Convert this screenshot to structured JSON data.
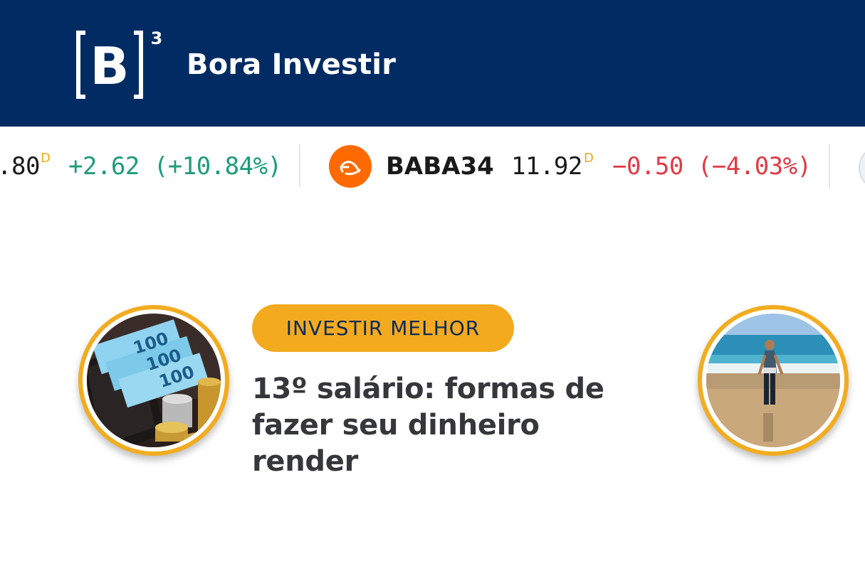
{
  "brand": {
    "name": "Bora Investir",
    "logo_letter": "B",
    "logo_superscript": "3"
  },
  "ticker": {
    "items": [
      {
        "symbol": "",
        "price": ".80",
        "marker": "D",
        "change": "+2.62 (+10.84%)",
        "direction": "up"
      },
      {
        "symbol": "BABA34",
        "price": "11.92",
        "marker": "D",
        "change": "−0.50 (−4.03%)",
        "direction": "down",
        "logo_icon": "alibaba-icon"
      }
    ],
    "colors": {
      "up": "#1e9b7b",
      "down": "#e03a44",
      "marker": "#f0a818"
    }
  },
  "featured": {
    "category": "INVESTIR MELHOR",
    "headline": "13º salário: formas de fazer seu dinheiro render",
    "left_image": "money-wallet-image",
    "right_image": "beach-walk-image"
  },
  "colors": {
    "header_bg": "#002c63",
    "accent": "#f3aa1f",
    "headline": "#36373b"
  }
}
